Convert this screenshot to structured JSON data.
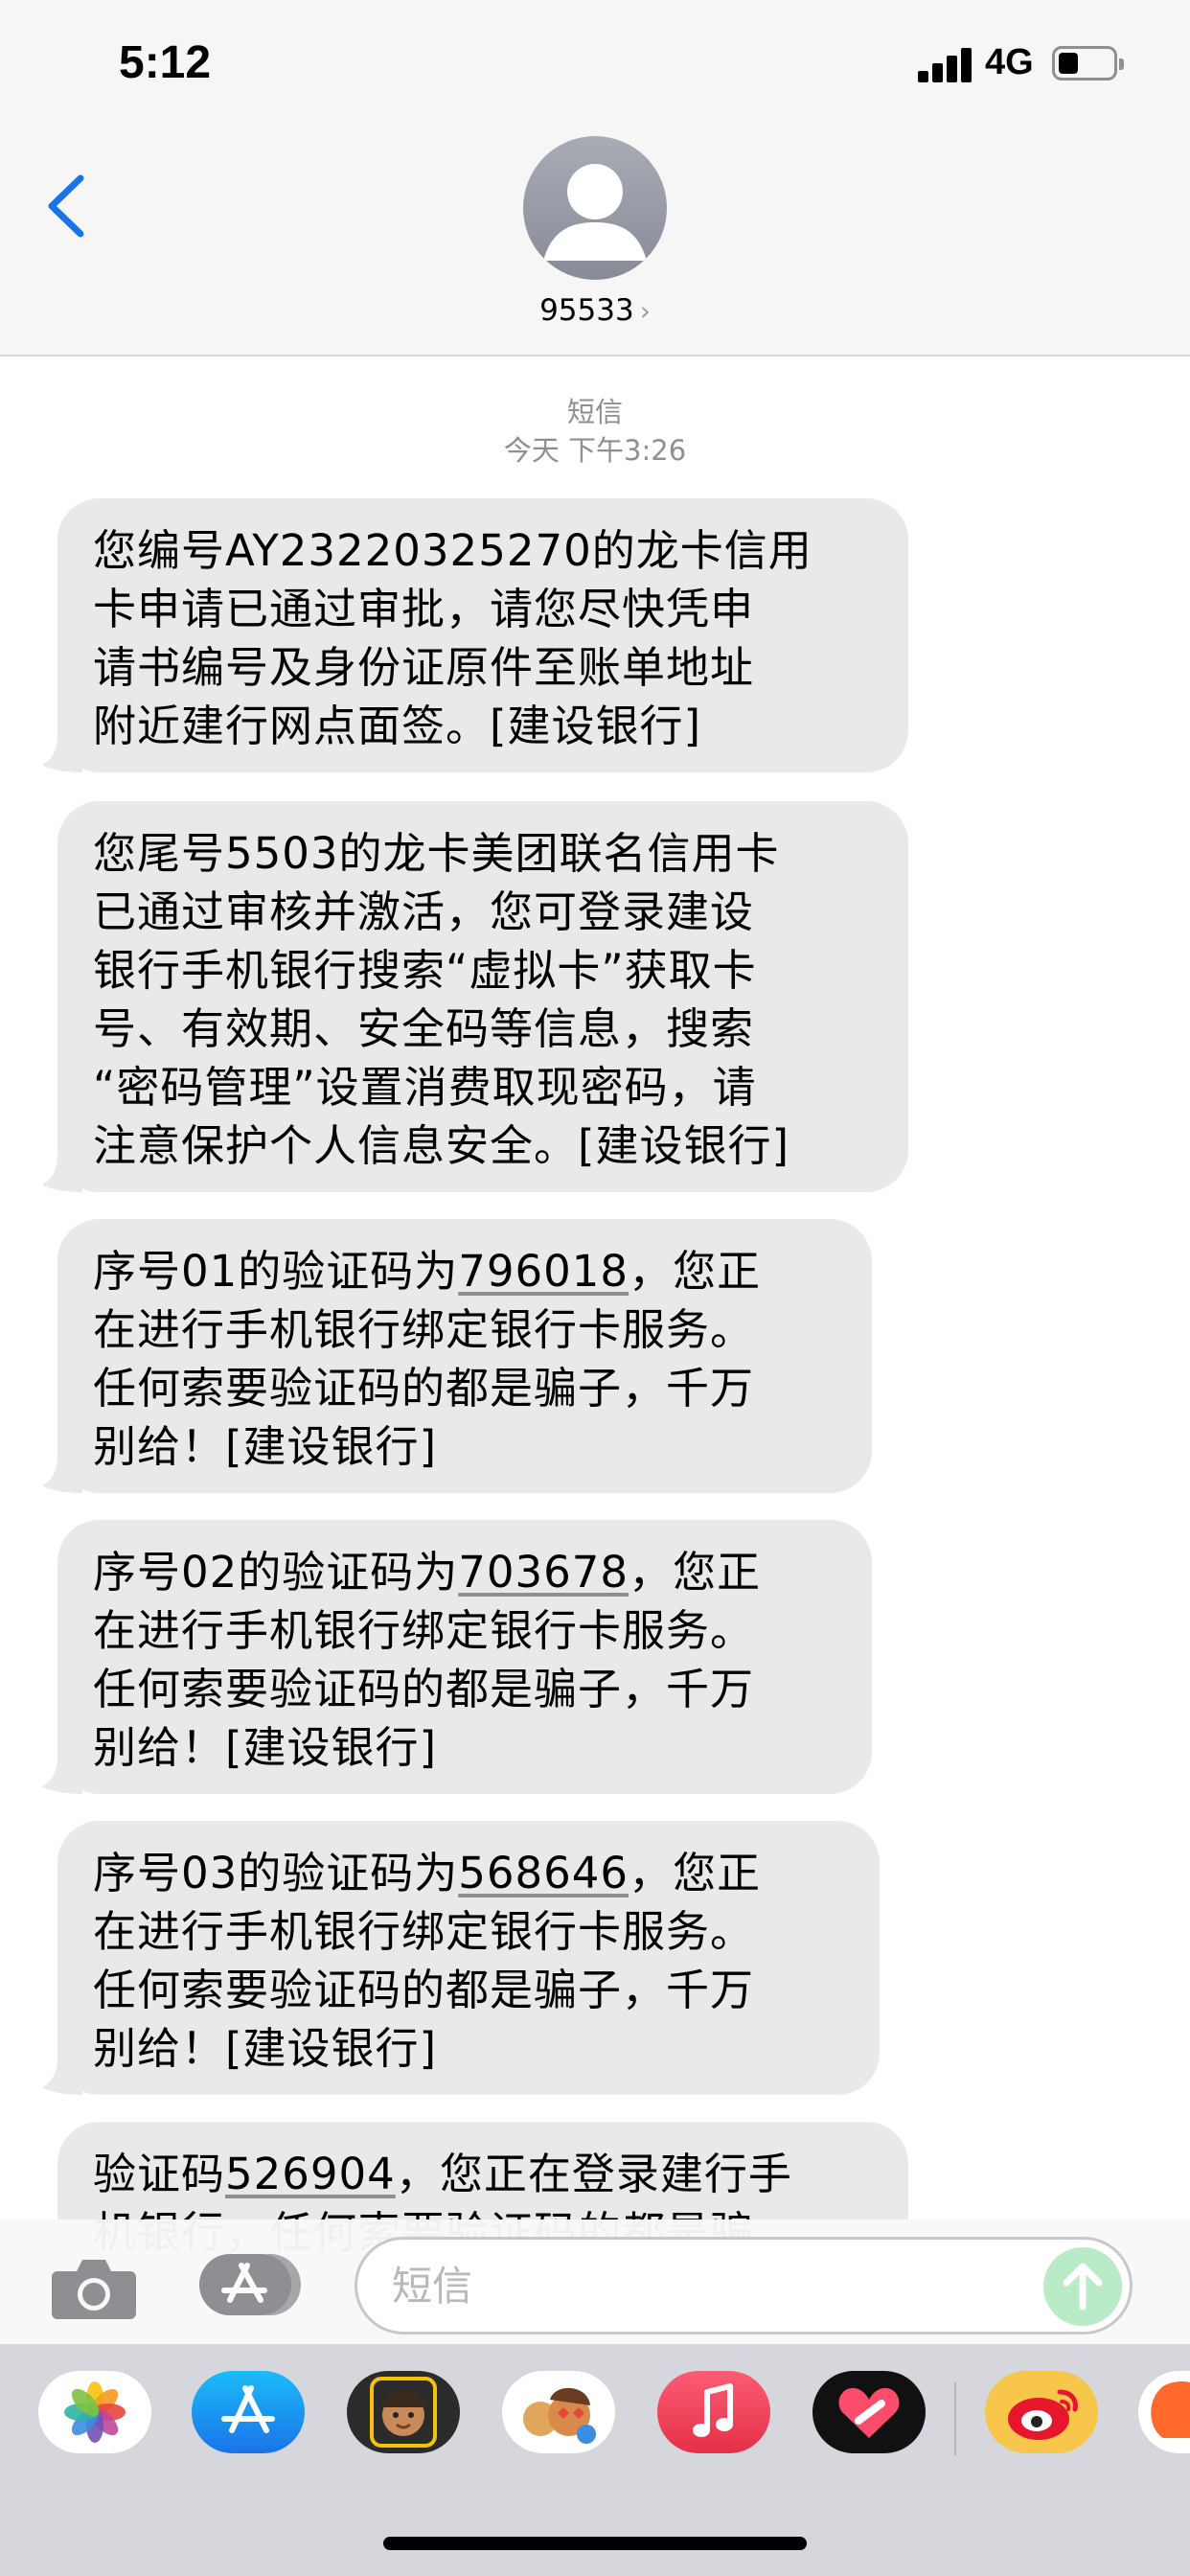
{
  "status_bar": {
    "time": "5:12",
    "network": "4G",
    "battery_level": 0.35
  },
  "header": {
    "contact": "95533",
    "chevron": "›"
  },
  "thread": {
    "stamp_kind": "短信",
    "stamp_time": "今天 下午3:26",
    "messages": [
      {
        "lines": [
          "您编号AY23220325270的龙卡信用",
          "卡申请已通过审批，请您尽快凭申",
          "请书编号及身份证原件至账单地址",
          "附近建行网点面签。[建设银行]"
        ]
      },
      {
        "lines": [
          "您尾号5503的龙卡美团联名信用卡",
          "已通过审核并激活，您可登录建设",
          "银行手机银行搜索“虚拟卡”获取卡",
          "号、有效期、安全码等信息，搜索",
          "“密码管理”设置消费取现密码，请",
          "注意保护个人信息安全。[建设银行]"
        ]
      },
      {
        "code": "796018",
        "prefix": "序号01的验证码为",
        "suffix": "，您正",
        "lines": [
          "在进行手机银行绑定银行卡服务。",
          "任何索要验证码的都是骗子，千万",
          "别给！[建设银行]"
        ]
      },
      {
        "code": "703678",
        "prefix": "序号02的验证码为",
        "suffix": "，您正",
        "lines": [
          "在进行手机银行绑定银行卡服务。",
          "任何索要验证码的都是骗子，千万",
          "别给！[建设银行]"
        ]
      },
      {
        "code": "568646",
        "prefix": "序号03的验证码为",
        "suffix": "，您正",
        "lines": [
          "在进行手机银行绑定银行卡服务。",
          "任何索要验证码的都是骗子，千万",
          "别给！[建设银行]"
        ]
      },
      {
        "code": "526904",
        "prefix": "验证码",
        "suffix": "，您正在登录建行手",
        "lines": [
          "机银行，任何索要验证码的都是骗"
        ]
      }
    ]
  },
  "compose": {
    "placeholder": "短信"
  },
  "app_drawer": {
    "apps": [
      "photos-app-icon",
      "app-store-app-icon",
      "memoji-app-icon",
      "animoji-app-icon",
      "music-app-icon",
      "digital-touch-app-icon",
      "weibo-app-icon",
      "partial-app-icon"
    ]
  },
  "colors": {
    "accent": "#1a73e8",
    "bubble": "#e9e9eb",
    "send": "#b9ecc6"
  }
}
